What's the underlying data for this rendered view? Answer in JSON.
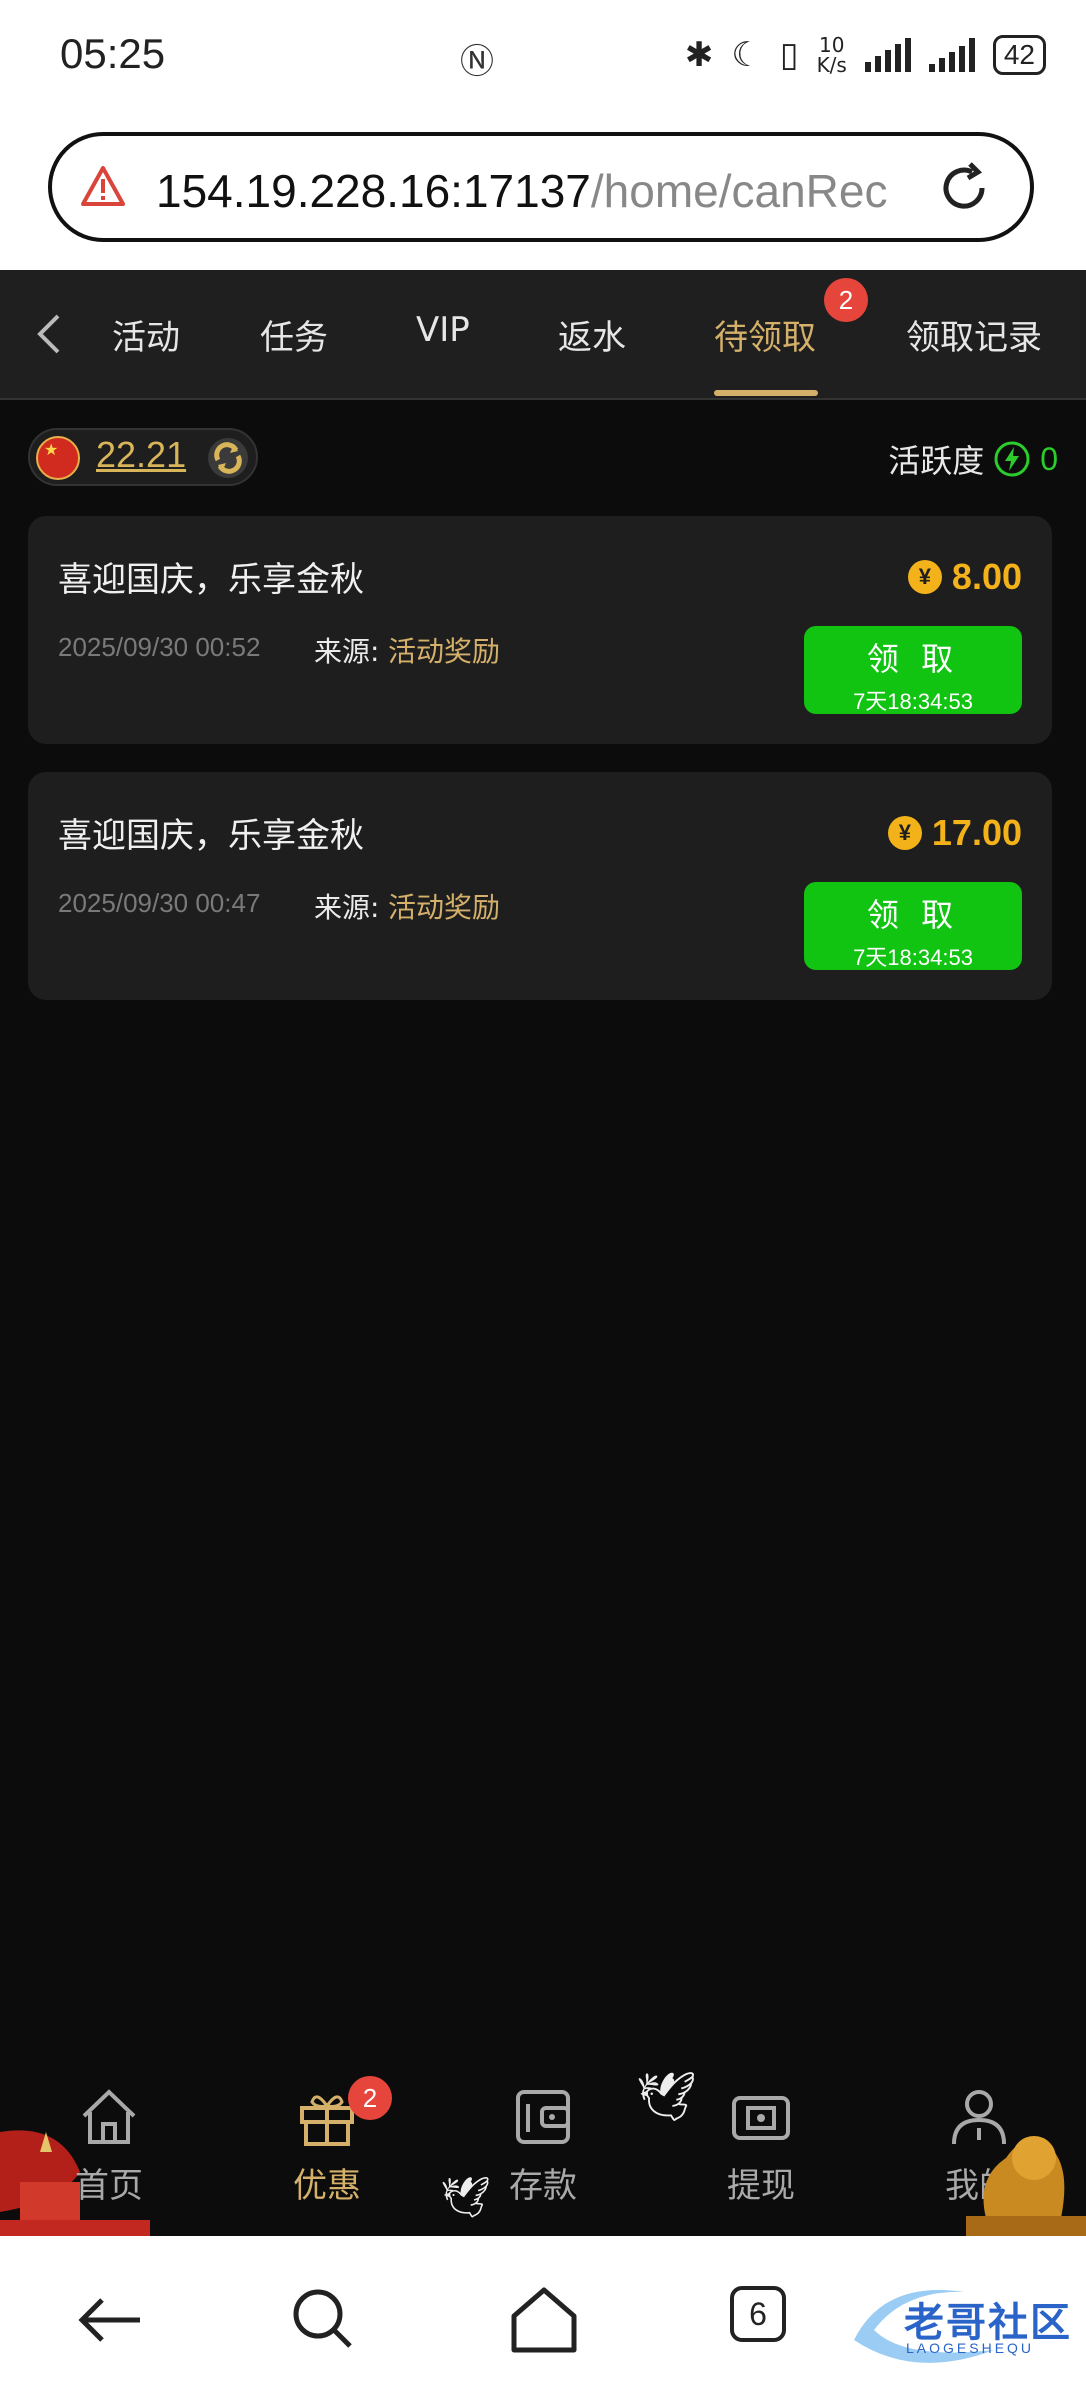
{
  "status_bar": {
    "time": "05:25",
    "net_speed_top": "10",
    "net_speed_bottom": "K/s",
    "battery": "42"
  },
  "browser": {
    "url_host": "154.19.228.16:17137",
    "url_path": "/home/canRec"
  },
  "tabs": [
    {
      "label": "活动"
    },
    {
      "label": "任务"
    },
    {
      "label": "VIP"
    },
    {
      "label": "返水"
    },
    {
      "label": "待领取",
      "badge": "2",
      "active": true
    },
    {
      "label": "领取记录"
    }
  ],
  "summary": {
    "balance": "22.21",
    "activity_label": "活跃度",
    "activity_value": "0"
  },
  "rewards": [
    {
      "title": "喜迎国庆，乐享金秋",
      "date": "2025/09/30 00:52",
      "source_label": "来源:",
      "source": "活动奖励",
      "amount": "8.00",
      "currency_symbol": "¥",
      "button_label": "领 取",
      "countdown": "7天18:34:53"
    },
    {
      "title": "喜迎国庆，乐享金秋",
      "date": "2025/09/30 00:47",
      "source_label": "来源:",
      "source": "活动奖励",
      "amount": "17.00",
      "currency_symbol": "¥",
      "button_label": "领 取",
      "countdown": "7天18:34:53"
    }
  ],
  "bottom_nav": [
    {
      "label": "首页",
      "icon": "home-icon"
    },
    {
      "label": "优惠",
      "icon": "gift-icon",
      "badge": "2",
      "active": true
    },
    {
      "label": "存款",
      "icon": "wallet-icon"
    },
    {
      "label": "提现",
      "icon": "withdraw-icon"
    },
    {
      "label": "我的",
      "icon": "user-icon"
    }
  ],
  "system_nav": {
    "tab_count": "6"
  },
  "watermark": {
    "text": "老哥社区",
    "sub": "LAOGESHEQU"
  },
  "colors": {
    "accent_gold": "#d4b06a",
    "claim_green": "#12c412",
    "amount_orange": "#f3b21a",
    "badge_red": "#e6453c"
  }
}
